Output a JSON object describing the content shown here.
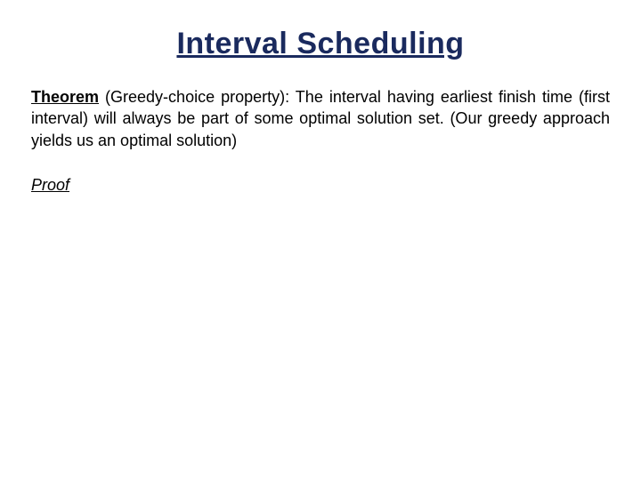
{
  "title": "Interval Scheduling",
  "theorem": {
    "label": "Theorem",
    "body": " (Greedy-choice property): The interval having earliest finish time (first interval) will always be part of some optimal solution set. (Our greedy approach yields us an optimal solution)"
  },
  "proof_label": "Proof"
}
